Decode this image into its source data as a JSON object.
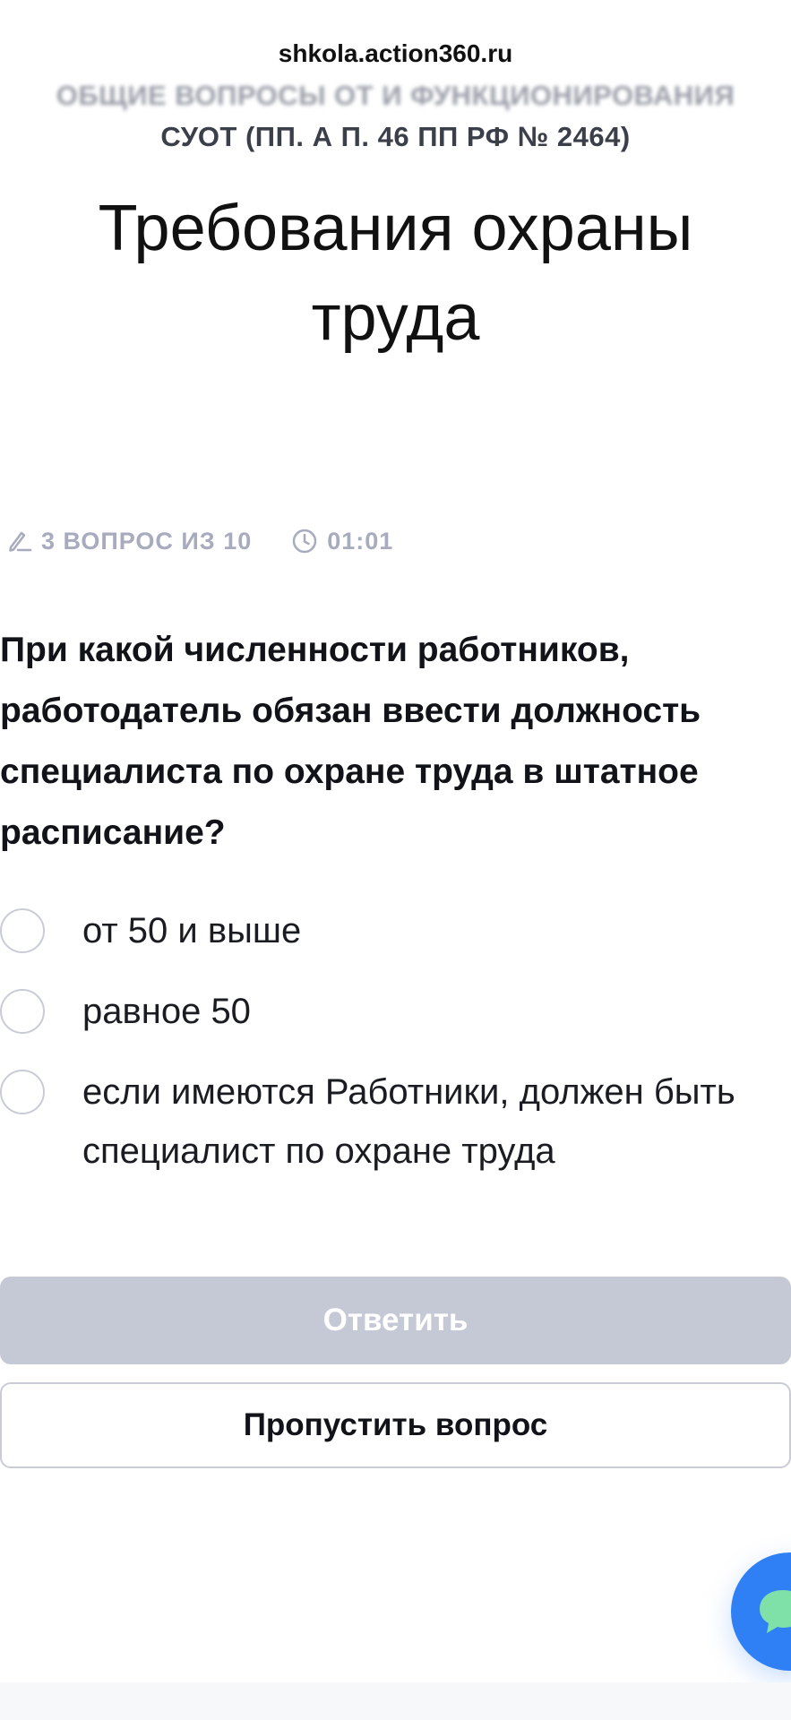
{
  "browser": {
    "url": "shkola.action360.ru"
  },
  "header": {
    "category_line1": "ОБЩИЕ ВОПРОСЫ ОТ И ФУНКЦИОНИРОВАНИЯ",
    "category_line2": "СУОТ (ПП. А П. 46 ПП РФ № 2464)",
    "title": "Требования охраны труда"
  },
  "quiz": {
    "progress_text": "3 ВОПРОС ИЗ 10",
    "current_question": 3,
    "total_questions": 10,
    "timer": "01:01",
    "question": "При какой численности работников, работодатель обязан ввести должность специалиста по охране труда в штатное расписание?",
    "options": [
      {
        "label": "от 50 и выше",
        "selected": false
      },
      {
        "label": "равное 50",
        "selected": false
      },
      {
        "label": "если имеются Работники, должен быть специалист по охране труда",
        "selected": false
      }
    ],
    "answer_button": "Ответить",
    "answer_button_enabled": false,
    "skip_button": "Пропустить вопрос"
  },
  "icons": {
    "progress": "pencil-icon",
    "timer": "clock-icon",
    "chat": "chat-bubble-icon"
  },
  "colors": {
    "text_primary": "#111318",
    "muted": "#a7abbd",
    "disabled_button": "#c5c9d5",
    "border": "#c9ccd6",
    "chat_button": "#2f7ff5",
    "chat_icon": "#7fe0a8"
  }
}
